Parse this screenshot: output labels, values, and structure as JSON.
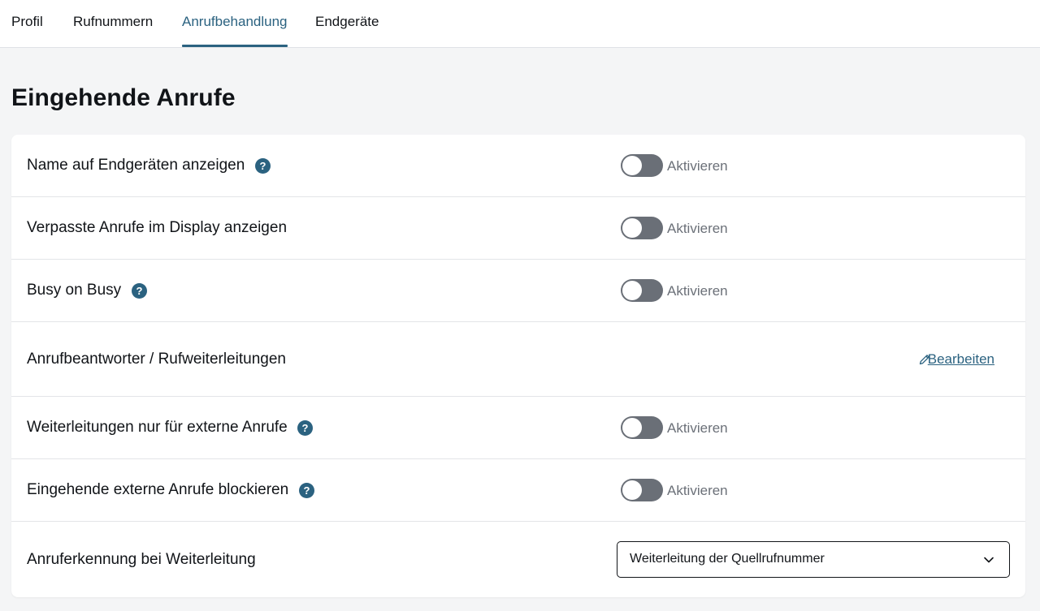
{
  "tabs": [
    {
      "label": "Profil"
    },
    {
      "label": "Rufnummern"
    },
    {
      "label": "Anrufbehandlung",
      "active": true
    },
    {
      "label": "Endgeräte"
    }
  ],
  "page_title": "Eingehende Anrufe",
  "toggle_label": "Aktivieren",
  "help_glyph": "?",
  "rows": [
    {
      "label": "Name auf Endgeräten anzeigen",
      "has_help": true,
      "toggle_on": false
    },
    {
      "label": "Verpasste Anrufe im Display anzeigen",
      "has_help": false,
      "toggle_on": false
    },
    {
      "label": "Busy on Busy",
      "has_help": true,
      "toggle_on": false
    },
    {
      "label": "Anrufbeantworter / Rufweiterleitungen",
      "action_label": "Bearbeiten",
      "action_icon": "pencil-icon"
    },
    {
      "label": "Weiterleitungen nur für externe Anrufe",
      "has_help": true,
      "toggle_on": false
    },
    {
      "label": "Eingehende externe Anrufe blockieren",
      "has_help": true,
      "toggle_on": false
    },
    {
      "label": "Anruferkennung bei Weiterleitung",
      "select_value": "Weiterleitung der Quellrufnummer",
      "select_icon": "chevron-down-icon"
    }
  ],
  "colors": {
    "accent": "#2b6280",
    "toggle_off": "#6a6f77",
    "background": "#f4f5f6"
  }
}
